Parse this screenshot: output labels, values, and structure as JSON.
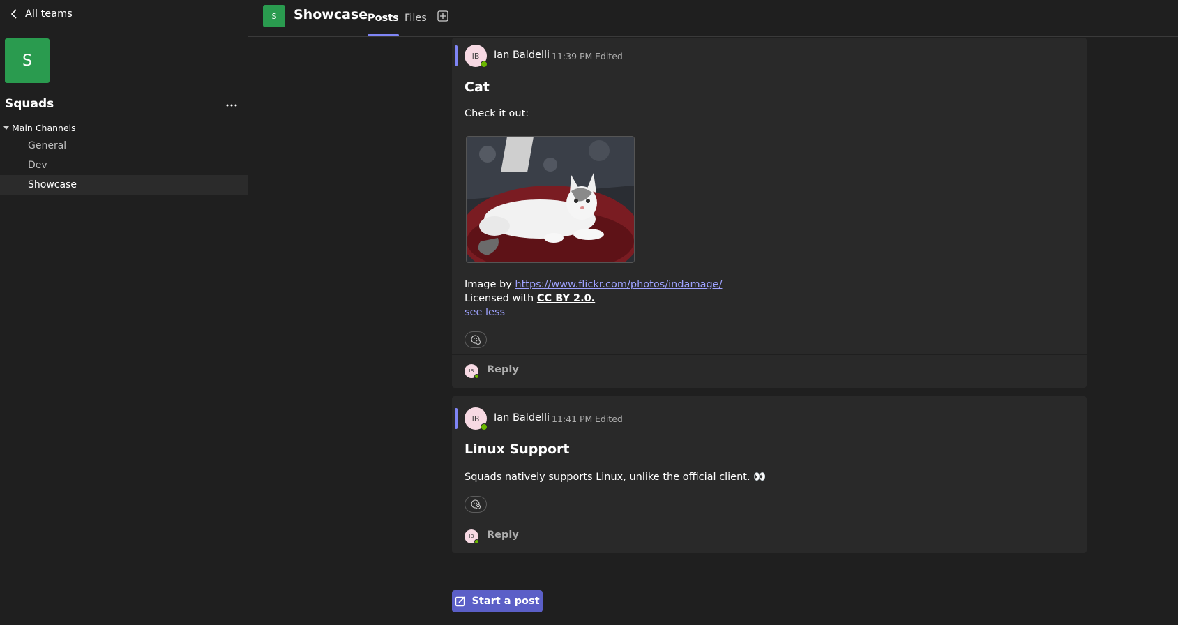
{
  "sidebar": {
    "back_label": "All teams",
    "team_initial": "S",
    "team_name": "Squads",
    "group_label": "Main Channels",
    "channels": [
      {
        "label": "General"
      },
      {
        "label": "Dev"
      },
      {
        "label": "Showcase",
        "active": true
      }
    ]
  },
  "header": {
    "channel_initial": "S",
    "channel_title": "Showcase",
    "tabs": [
      {
        "label": "Posts",
        "active": true
      },
      {
        "label": "Files"
      }
    ]
  },
  "posts": [
    {
      "avatar_initials": "IB",
      "author": "Ian Baldelli",
      "time": "11:39 PM",
      "edited": "Edited",
      "title": "Cat",
      "intro": "Check it out:",
      "image_alt": "white kitten on red cushion",
      "credit_prefix": "Image by ",
      "credit_link": "https://www.flickr.com/photos/indamage/",
      "license_prefix": "Licensed with ",
      "license_link": "CC BY 2.0.",
      "see_less": "see less",
      "reply_label": "Reply"
    },
    {
      "avatar_initials": "IB",
      "author": "Ian Baldelli",
      "time": "11:41 PM",
      "edited": "Edited",
      "title": "Linux Support",
      "body": "Squads natively supports Linux, unlike the official client. 👀",
      "reply_label": "Reply"
    }
  ],
  "start_post_label": "Start a post",
  "colors": {
    "accent": "#7f85f5",
    "team_green": "#2a9b4f",
    "button": "#5b5fc7",
    "presence": "#6bb700"
  }
}
